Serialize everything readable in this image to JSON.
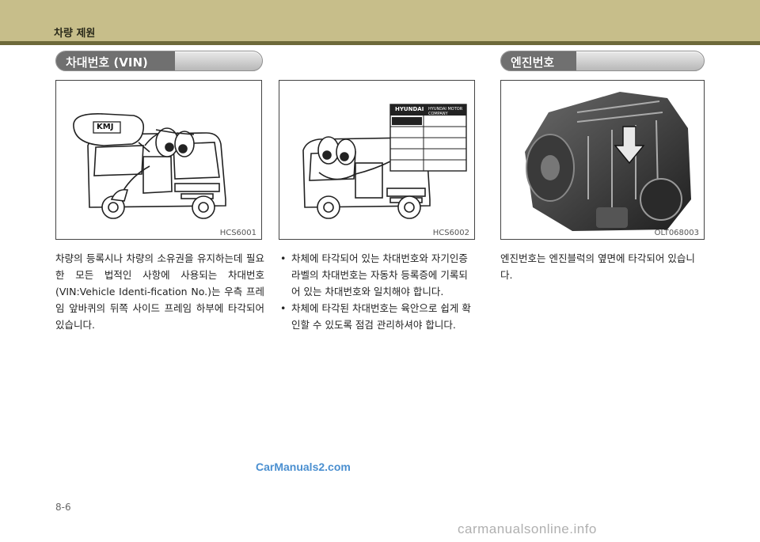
{
  "header": {
    "chapter_title": "차량 제원"
  },
  "sections": {
    "vin": {
      "title": "차대번호 (VIN)"
    },
    "engine": {
      "title": "엔진번호"
    }
  },
  "figures": [
    {
      "code": "HCS6001",
      "badge_text": "KMJ"
    },
    {
      "code": "HCS6002",
      "label_brand": "HYUNDAI",
      "label_header": "HYUNDAI MOTOR COMPANY"
    },
    {
      "code": "OLT068003"
    }
  ],
  "body": {
    "col1": "차량의 등록시나 차량의 소유권을 유지하는데 필요한 모든 법적인 사항에 사용되는 차대번호(VIN:Vehicle Identi-fication No.)는 우측 프레임 앞바퀴의 뒤쪽 사이드 프레임 하부에 타각되어 있습니다.",
    "col2_items": [
      "차체에 타각되어 있는 차대번호와 자기인증 라벨의 차대번호는 자동차 등록증에 기록되어 있는 차대번호와 일치해야 합니다.",
      "차체에 타각된 차대번호는 육안으로 쉽게 확인할 수 있도록 점검 관리하셔야 합니다."
    ],
    "bullet": "•",
    "col3": "엔진번호는 엔진블럭의 옆면에 타각되어 있습니다."
  },
  "footer": {
    "watermark": "CarManuals2.com",
    "page_number": "8-6",
    "site_watermark": "carmanualsonline.info"
  }
}
